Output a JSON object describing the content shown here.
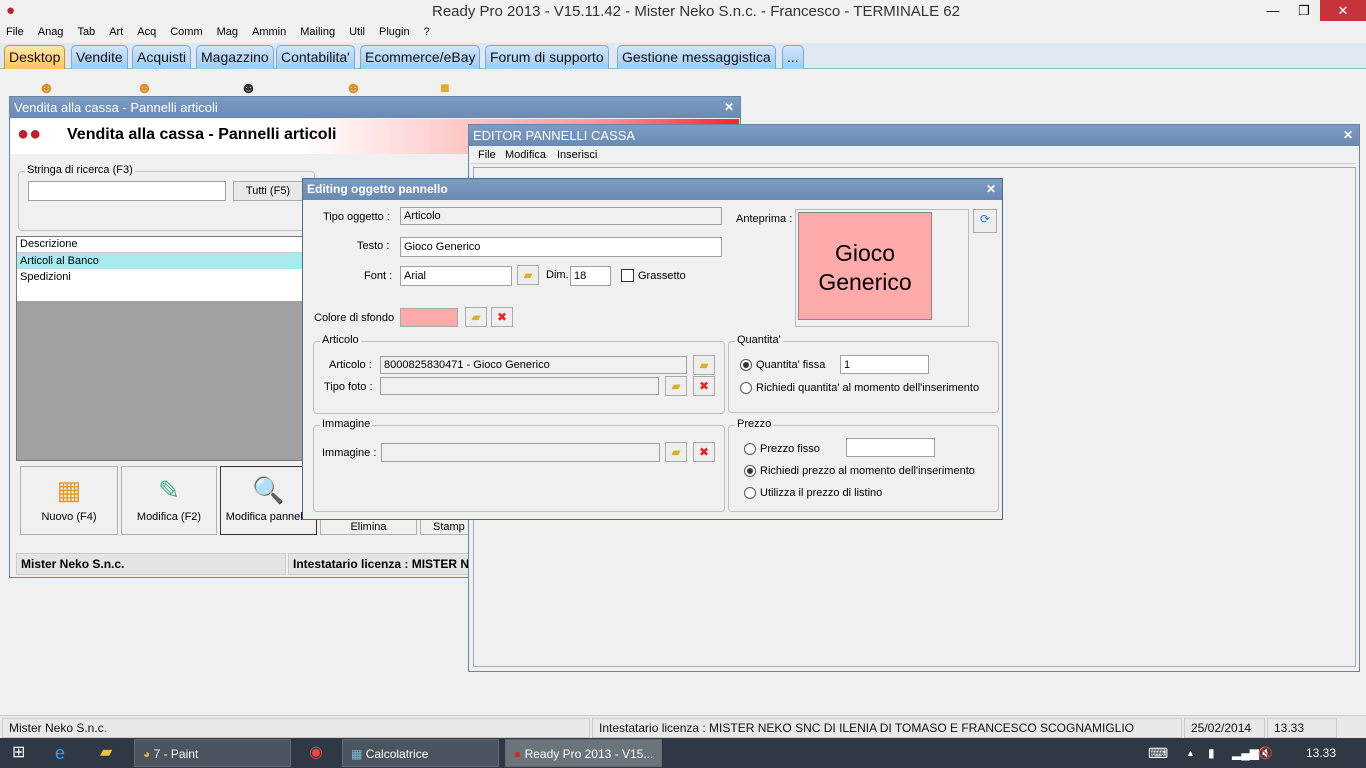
{
  "app": {
    "title": "Ready Pro 2013 - V15.11.42 - Mister Neko S.n.c. - Francesco - TERMINALE 62"
  },
  "menu": [
    "File",
    "Anag",
    "Tab",
    "Art",
    "Acq",
    "Comm",
    "Mag",
    "Ammin",
    "Mailing",
    "Util",
    "Plugin",
    "?"
  ],
  "tabs": [
    "Desktop",
    "Vendite",
    "Acquisti",
    "Magazzino",
    "Contabilita'",
    "Ecommerce/eBay",
    "Forum di supporto",
    "Gestione messaggistica",
    "..."
  ],
  "vendita": {
    "window_title": "Vendita alla cassa - Pannelli articoli",
    "header": "Vendita alla cassa - Pannelli articoli",
    "search_group": "Stringa di ricerca (F3)",
    "search_value": "",
    "all_button": "Tutti (F5)",
    "list_header": "Descrizione",
    "rows": [
      "Articoli al Banco",
      "Spedizioni"
    ],
    "buttons": [
      "Nuovo (F4)",
      "Modifica (F2)",
      "Modifica pannello",
      "Elimina",
      "Stamp"
    ],
    "status_left": "Mister Neko S.n.c.",
    "status_right": "Intestatario licenza : MISTER NE"
  },
  "editor": {
    "window_title": "EDITOR PANNELLI CASSA",
    "menu": [
      "File",
      "Modifica",
      "Inserisci"
    ]
  },
  "dialog": {
    "title": "Editing oggetto pannello",
    "tipo_label": "Tipo oggetto :",
    "tipo_value": "Articolo",
    "testo_label": "Testo :",
    "testo_value": "Gioco Generico",
    "font_label": "Font :",
    "font_value": "Arial",
    "dim_label": "Dim.",
    "dim_value": "18",
    "bold_label": "Grassetto",
    "bold_checked": false,
    "colore_label": "Colore di sfondo",
    "colore_value": "#ffaaaa",
    "anteprima_label": "Anteprima :",
    "anteprima_text": "Gioco Generico",
    "articolo_group": "Articolo",
    "articolo_label": "Articolo :",
    "articolo_value": "8000825830471 - Gioco Generico",
    "tipofoto_label": "Tipo foto :",
    "tipofoto_value": "",
    "immagine_group": "Immagine",
    "immagine_label": "Immagine :",
    "immagine_value": "",
    "quantita_group": "Quantita'",
    "q_fissa": "Quantita' fissa",
    "q_value": "1",
    "q_richiedi": "Richiedi quantita' al momento dell'inserimento",
    "q_selected": "fissa",
    "prezzo_group": "Prezzo",
    "p_fisso": "Prezzo fisso",
    "p_value": "",
    "p_richiedi": "Richiedi prezzo al momento dell'inserimento",
    "p_listino": "Utilizza il prezzo di listino",
    "p_selected": "richiedi"
  },
  "statusbar": {
    "company": "Mister Neko S.n.c.",
    "license": "Intestatario licenza : MISTER NEKO SNC DI ILENIA DI TOMASO E FRANCESCO SCOGNAMIGLIO",
    "date": "25/02/2014",
    "time": "13.33"
  },
  "taskbar": {
    "items": [
      "7 - Paint",
      "Calcolatrice",
      "Ready Pro 2013 - V15..."
    ],
    "clock": "13.33"
  }
}
